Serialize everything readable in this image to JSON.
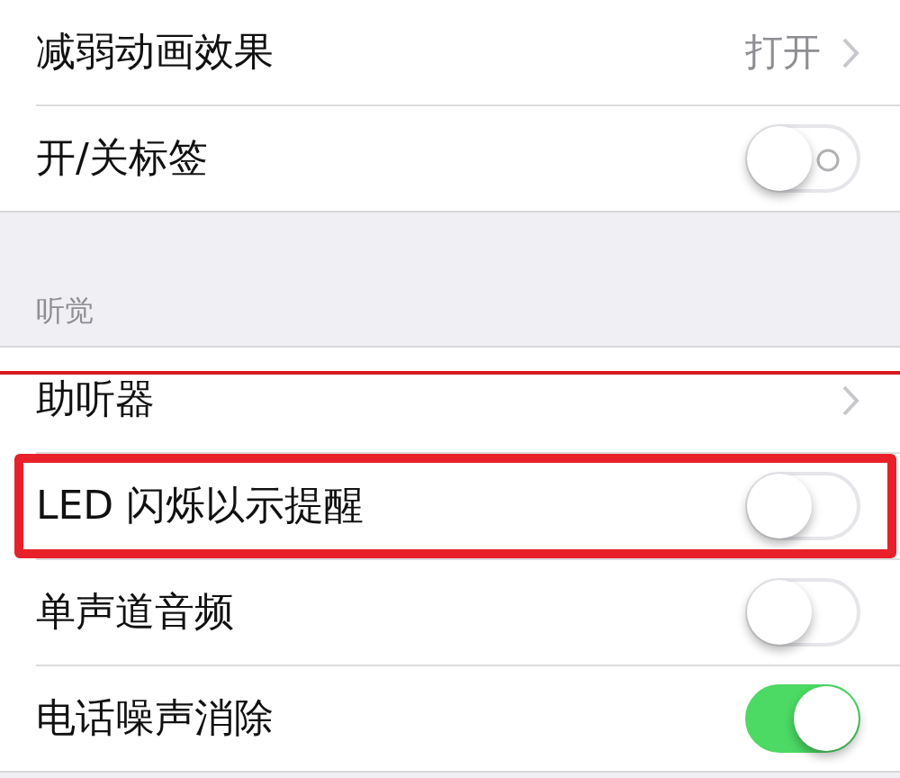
{
  "sections": [
    {
      "rows": [
        {
          "kind": "value",
          "label": "减弱动画效果",
          "value": "打开"
        },
        {
          "kind": "toggle",
          "label": "开/关标签",
          "on": false,
          "label_mark": true
        }
      ]
    },
    {
      "header": "听觉",
      "rows": [
        {
          "kind": "link",
          "label": "助听器",
          "struck": true
        },
        {
          "kind": "toggle",
          "label": "LED 闪烁以示提醒",
          "on": false,
          "highlighted": true
        },
        {
          "kind": "toggle",
          "label": "单声道音频",
          "on": false
        },
        {
          "kind": "toggle",
          "label": "电话噪声消除",
          "on": true
        }
      ]
    }
  ]
}
